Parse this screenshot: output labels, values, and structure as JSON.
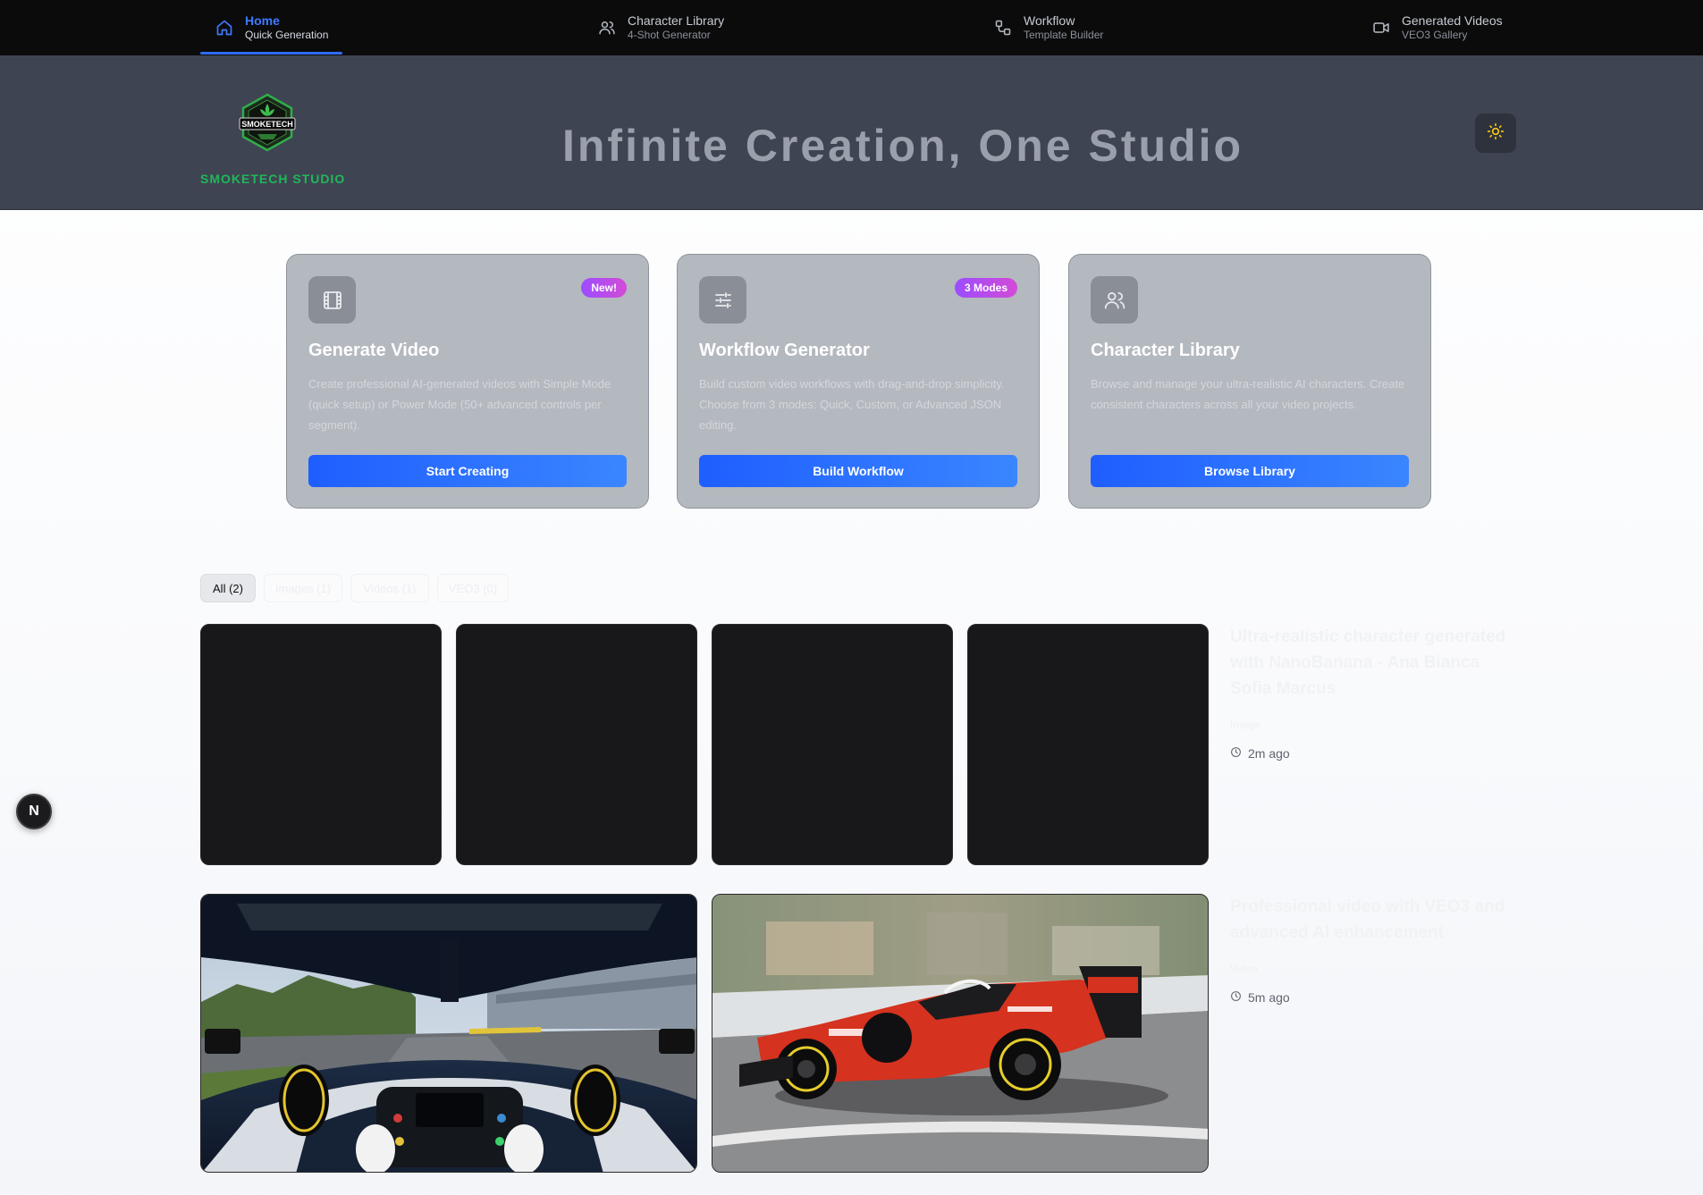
{
  "nav": {
    "items": [
      {
        "label": "Home",
        "sub": "Quick Generation",
        "icon": "home-icon"
      },
      {
        "label": "Character Library",
        "sub": "4-Shot Generator",
        "icon": "users-icon"
      },
      {
        "label": "Workflow",
        "sub": "Template Builder",
        "icon": "workflow-icon"
      },
      {
        "label": "Generated Videos",
        "sub": "VEO3 Gallery",
        "icon": "video-camera-icon"
      }
    ],
    "active_index": 0
  },
  "hero": {
    "logo_text": "SMOKETECH",
    "brand": "SMOKETECH STUDIO",
    "title": "Infinite Creation, One Studio",
    "theme_icon": "sun-icon"
  },
  "cards": [
    {
      "icon": "film-icon",
      "badge": "New!",
      "title": "Generate Video",
      "desc": "Create professional AI-generated videos with Simple Mode (quick setup) or Power Mode (50+ advanced controls per segment).",
      "button": "Start Creating"
    },
    {
      "icon": "sliders-icon",
      "badge": "3 Modes",
      "title": "Workflow Generator",
      "desc": "Build custom video workflows with drag-and-drop simplicity. Choose from 3 modes: Quick, Custom, or Advanced JSON editing.",
      "button": "Build Workflow"
    },
    {
      "icon": "users-icon",
      "badge": "",
      "title": "Character Library",
      "desc": "Browse and manage your ultra-realistic AI characters. Create consistent characters across all your video projects.",
      "button": "Browse Library"
    }
  ],
  "filters": [
    "All (2)",
    "Images (1)",
    "Videos (1)",
    "VEO3 (0)"
  ],
  "gallery": [
    {
      "title": "Ultra-realistic character generated with NanoBanana - Ana Bianca Sofia Marcus",
      "tag": "Image",
      "time": "2m ago",
      "thumbs": 4
    },
    {
      "title": "Professional video with VEO3 and advanced AI enhancement",
      "tag": "Video",
      "time": "5m ago",
      "thumbs": 2
    }
  ],
  "colors": {
    "nav_bg": "#0b0b0c",
    "hero_bg": "#3f4452",
    "accent": "#2f6bff",
    "brand_green": "#1fb85a",
    "card_bg": "#b4b8bf"
  },
  "dev_badge": "N"
}
